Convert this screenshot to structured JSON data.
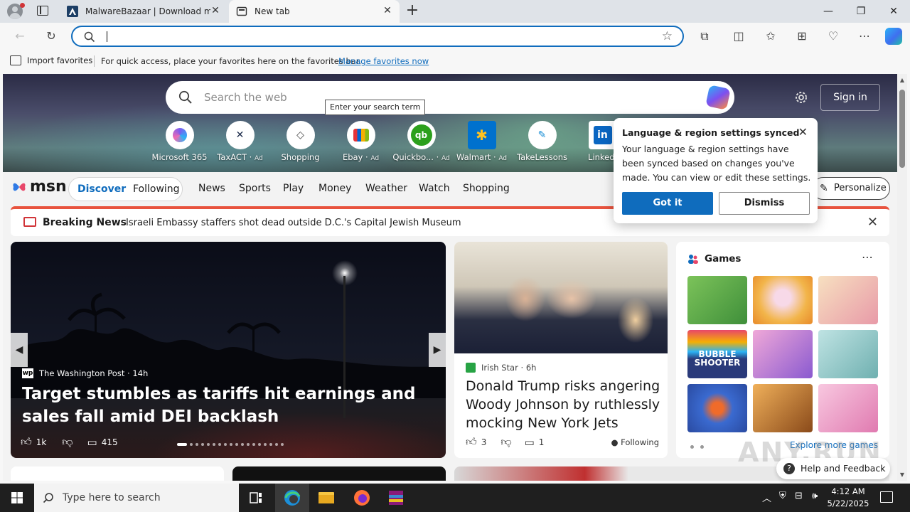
{
  "browser": {
    "tabs": [
      {
        "title": "MalwareBazaar | Download malware samples",
        "active": false
      },
      {
        "title": "New tab",
        "active": true
      }
    ],
    "address": {
      "value": "",
      "placeholder": ""
    },
    "favorites_bar": {
      "import_label": "Import favorites",
      "message": "For quick access, place your favorites here on the favorites bar.",
      "manage_link": "Manage favorites now"
    }
  },
  "msn": {
    "search": {
      "placeholder": "Search the web",
      "tooltip": "Enter your search term"
    },
    "sign_in": "Sign in",
    "quick_links": [
      {
        "label": "Microsoft 365",
        "ad": "",
        "icon": "microsoft-365-icon",
        "color": "#7a5cf0"
      },
      {
        "label": "TaxACT",
        "ad": "Ad",
        "icon": "taxact-icon",
        "color": "#1b2a4a"
      },
      {
        "label": "Shopping",
        "ad": "",
        "icon": "shopping-tag-icon",
        "color": "#444444"
      },
      {
        "label": "Ebay",
        "ad": "Ad",
        "icon": "ebay-bag-icon",
        "color": "#e53238"
      },
      {
        "label": "Quickbo...",
        "ad": "Ad",
        "icon": "quickbooks-icon",
        "color": "#2ca01c"
      },
      {
        "label": "Walmart",
        "ad": "Ad",
        "icon": "walmart-icon",
        "color": "#0071ce"
      },
      {
        "label": "TakeLessons",
        "ad": "",
        "icon": "takelessons-icon",
        "color": "#1a8fd6"
      },
      {
        "label": "LinkedI",
        "ad": "",
        "icon": "linkedin-icon",
        "color": "#0a66c2"
      }
    ],
    "logo_text": "msn",
    "feed_tabs": {
      "discover": "Discover",
      "following": "Following"
    },
    "nav_links": [
      "News",
      "Sports",
      "Play",
      "Money",
      "Weather",
      "Watch",
      "Shopping"
    ],
    "personalize": "Personalize",
    "breaking": {
      "label": "Breaking News",
      "text": "Israeli Embassy staffers shot dead outside D.C.'s Capital Jewish Museum"
    },
    "main_story": {
      "source": "The Washington Post",
      "source_logo": "wp",
      "age": "14h",
      "headline": "Target stumbles as tariffs hit earnings and sales fall amid DEI backlash",
      "likes": "1k",
      "comments": "415"
    },
    "second_story": {
      "source": "Irish Star",
      "age": "6h",
      "headline": "Donald Trump risks angering Woody Johnson by ruthlessly mocking New York Jets",
      "likes": "3",
      "comments": "1",
      "follow_label": "Following"
    },
    "games": {
      "title": "Games",
      "explore": "Explore more games",
      "tiles": [
        {
          "name": "game-tile-puzzle",
          "color": "#5aa84a"
        },
        {
          "name": "game-tile-cupcake",
          "color": "#f2b54a"
        },
        {
          "name": "game-tile-fashion",
          "color": "#f2c7a0"
        },
        {
          "name": "game-tile-bubble-shooter",
          "color": "#2a3a7a",
          "label": "BUBBLE SHOOTER"
        },
        {
          "name": "game-tile-makeup",
          "color": "#c77ad0"
        },
        {
          "name": "game-tile-doctor",
          "color": "#8fc8c8"
        },
        {
          "name": "game-tile-fish",
          "color": "#3a6ad0"
        },
        {
          "name": "game-tile-adventure",
          "color": "#c7742a"
        },
        {
          "name": "game-tile-dressup",
          "color": "#f2a0c8"
        }
      ]
    },
    "help": "Help and Feedback"
  },
  "popup": {
    "title": "Language & region settings synced",
    "body": "Your language & region settings have been synced based on changes you've made. You can view or edit these settings.",
    "got_it": "Got it",
    "dismiss": "Dismiss"
  },
  "watermark": "ANY.RUN",
  "taskbar": {
    "search_placeholder": "Type here to search",
    "time": "4:12 AM",
    "date": "5/22/2025"
  }
}
